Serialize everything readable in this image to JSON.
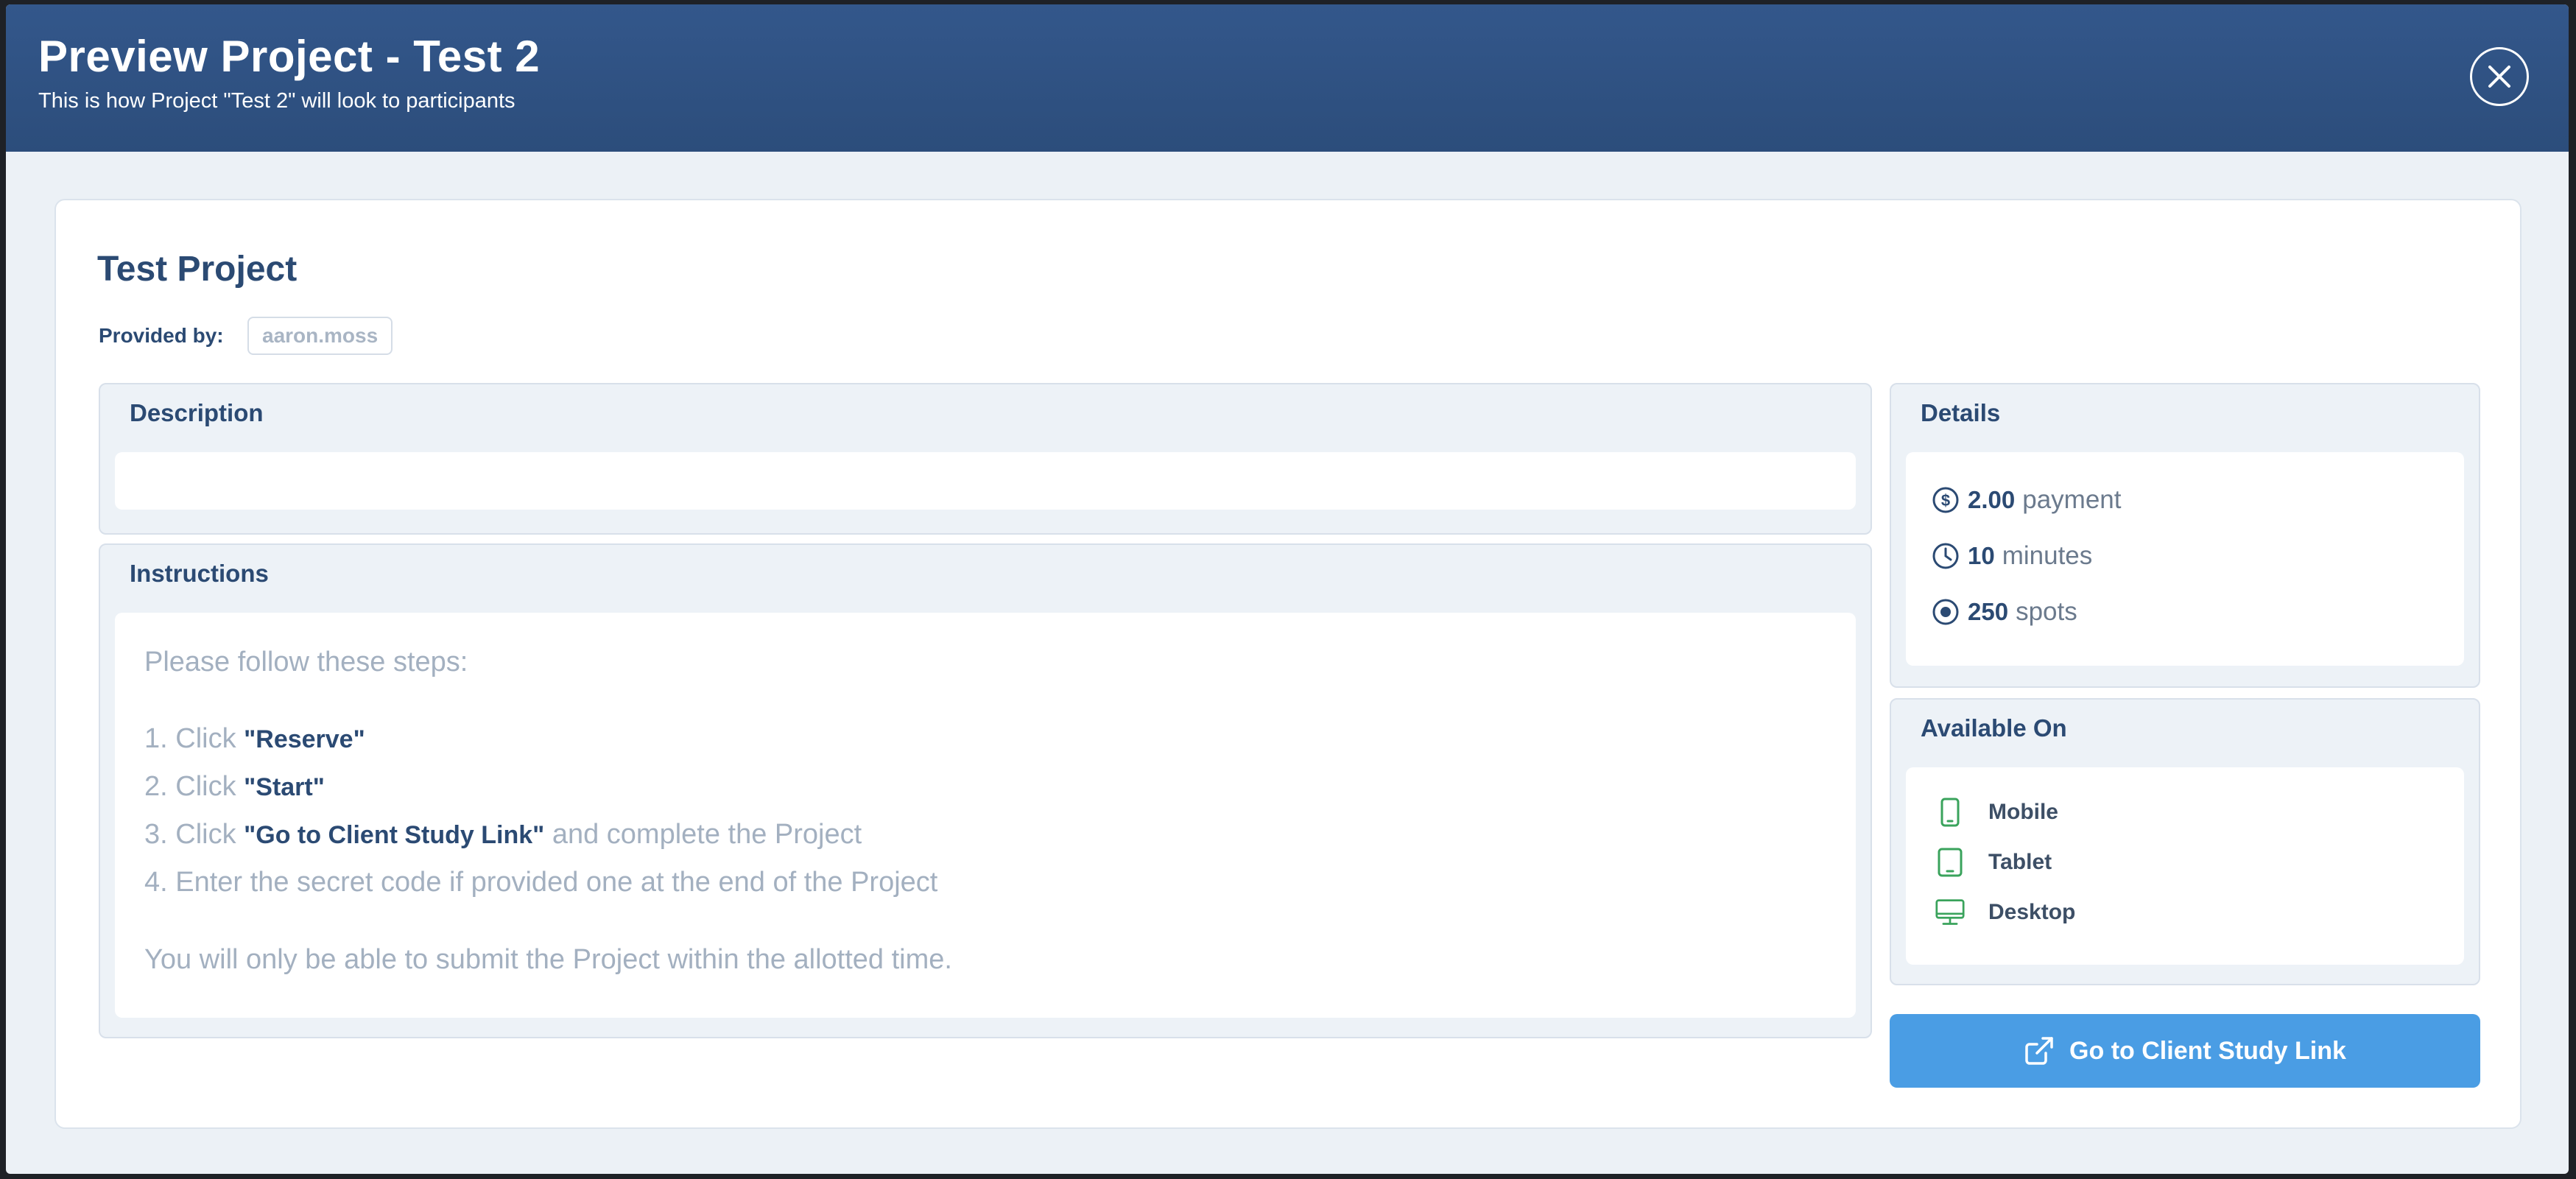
{
  "modal": {
    "title": "Preview Project - Test 2",
    "subtitle": "This is how Project \"Test 2\" will look to participants"
  },
  "project": {
    "title": "Test Project",
    "provided_by_label": "Provided by:",
    "provider": "aaron.moss"
  },
  "description": {
    "title": "Description",
    "body": ""
  },
  "instructions": {
    "title": "Instructions",
    "intro": "Please follow these steps:",
    "steps": [
      {
        "prefix": "1. Click ",
        "bold": "\"Reserve\"",
        "suffix": ""
      },
      {
        "prefix": "2. Click ",
        "bold": "\"Start\"",
        "suffix": ""
      },
      {
        "prefix": "3. Click ",
        "bold": "\"Go to Client Study Link\"",
        "suffix": " and complete the Project"
      },
      {
        "prefix": "4. Enter the secret code if provided one at the end of the Project",
        "bold": "",
        "suffix": ""
      }
    ],
    "note": "You will only be able to submit the Project within the allotted time."
  },
  "details": {
    "title": "Details",
    "items": [
      {
        "icon": "dollar-icon",
        "value": "2.00",
        "label": "payment"
      },
      {
        "icon": "clock-icon",
        "value": "10",
        "label": "minutes"
      },
      {
        "icon": "spots-icon",
        "value": "250",
        "label": "spots"
      }
    ]
  },
  "available_on": {
    "title": "Available On",
    "devices": [
      {
        "icon": "mobile-icon",
        "label": "Mobile"
      },
      {
        "icon": "tablet-icon",
        "label": "Tablet"
      },
      {
        "icon": "desktop-icon",
        "label": "Desktop"
      }
    ]
  },
  "cta": {
    "label": "Go to Client Study Link",
    "icon": "external-link-icon"
  },
  "colors": {
    "header": "#2f5283",
    "accent": "#4a9de4",
    "device_icon": "#3aa35c",
    "heading_text": "#2b4a73"
  }
}
